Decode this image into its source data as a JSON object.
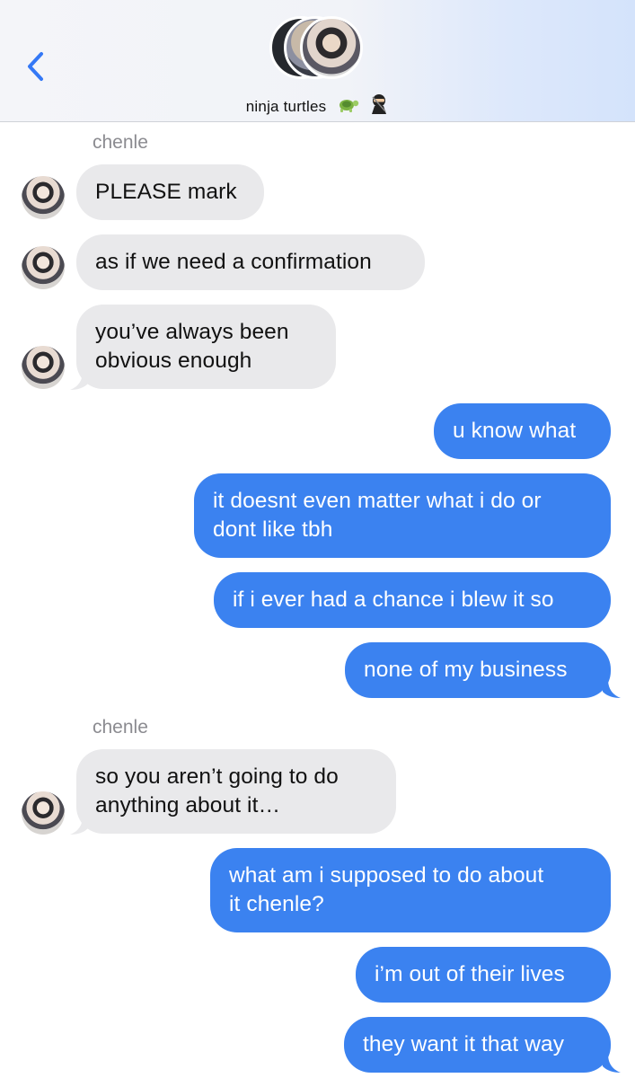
{
  "header": {
    "group_name": "ninja turtles",
    "emoji_1": "turtle",
    "emoji_2": "ninja",
    "back_icon": "chevron-left-icon",
    "accent_color": "#3478f6"
  },
  "conversation": {
    "sender_1": "chenle",
    "incoming_1": [
      "PLEASE mark",
      "as if we need a confirmation",
      "you’ve always been\nobvious enough"
    ],
    "outgoing_1": [
      "u know what",
      "it doesnt even matter what i do or\ndont like tbh",
      "if i ever had a chance i blew it so",
      "none of my business"
    ],
    "sender_2": "chenle",
    "incoming_2": [
      "so you aren’t going to do\nanything about it…"
    ],
    "outgoing_2": [
      "what am i supposed to do about\nit chenle?",
      "i’m out of their lives",
      "they want it that way"
    ]
  },
  "colors": {
    "incoming_bubble": "#e9e9eb",
    "outgoing_bubble": "#3b82f0",
    "sender_label": "#8b8b90"
  }
}
